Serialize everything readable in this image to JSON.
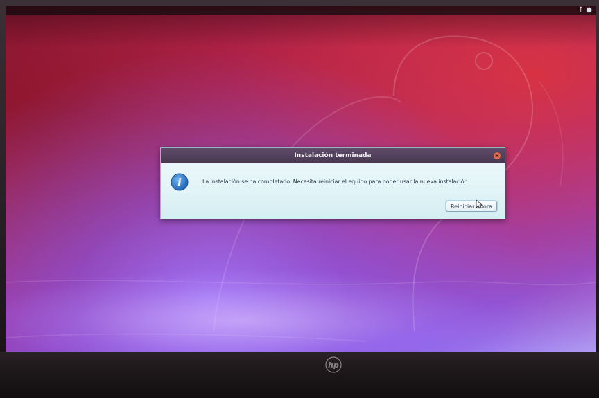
{
  "dialog": {
    "title": "Instalación terminada",
    "message": "La instalación se ha completado. Necesita reiniciar el equipo para poder usar la nueva instalación.",
    "restart_label": "Reiniciar ahora"
  },
  "icons": {
    "info": "info-icon",
    "close": "close-icon",
    "indicators": [
      "network-icon",
      "power-icon"
    ],
    "brand": "hp-logo"
  },
  "colors": {
    "titlebar": "#4f3f59",
    "close": "#e46a4a",
    "info": "#2f7fd0",
    "dialog_bg": "#e6f5f8"
  }
}
